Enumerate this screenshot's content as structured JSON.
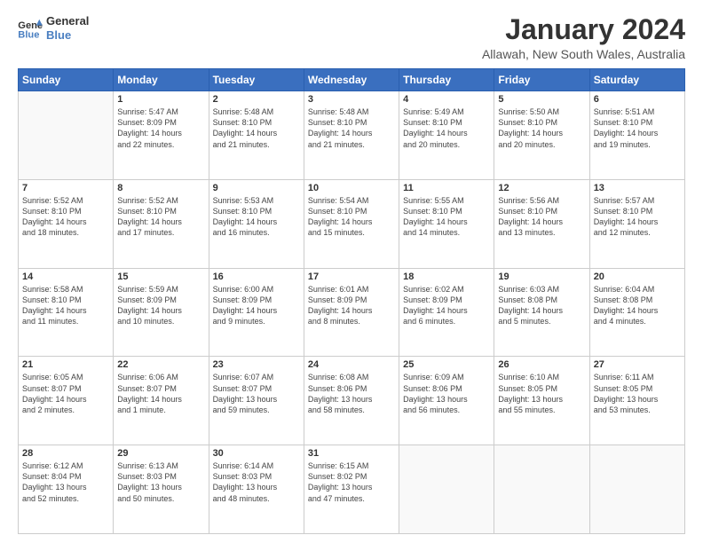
{
  "logo": {
    "line1": "General",
    "line2": "Blue"
  },
  "title": "January 2024",
  "subtitle": "Allawah, New South Wales, Australia",
  "weekdays": [
    "Sunday",
    "Monday",
    "Tuesday",
    "Wednesday",
    "Thursday",
    "Friday",
    "Saturday"
  ],
  "weeks": [
    [
      {
        "day": "",
        "info": ""
      },
      {
        "day": "1",
        "info": "Sunrise: 5:47 AM\nSunset: 8:09 PM\nDaylight: 14 hours\nand 22 minutes."
      },
      {
        "day": "2",
        "info": "Sunrise: 5:48 AM\nSunset: 8:10 PM\nDaylight: 14 hours\nand 21 minutes."
      },
      {
        "day": "3",
        "info": "Sunrise: 5:48 AM\nSunset: 8:10 PM\nDaylight: 14 hours\nand 21 minutes."
      },
      {
        "day": "4",
        "info": "Sunrise: 5:49 AM\nSunset: 8:10 PM\nDaylight: 14 hours\nand 20 minutes."
      },
      {
        "day": "5",
        "info": "Sunrise: 5:50 AM\nSunset: 8:10 PM\nDaylight: 14 hours\nand 20 minutes."
      },
      {
        "day": "6",
        "info": "Sunrise: 5:51 AM\nSunset: 8:10 PM\nDaylight: 14 hours\nand 19 minutes."
      }
    ],
    [
      {
        "day": "7",
        "info": "Sunrise: 5:52 AM\nSunset: 8:10 PM\nDaylight: 14 hours\nand 18 minutes."
      },
      {
        "day": "8",
        "info": "Sunrise: 5:52 AM\nSunset: 8:10 PM\nDaylight: 14 hours\nand 17 minutes."
      },
      {
        "day": "9",
        "info": "Sunrise: 5:53 AM\nSunset: 8:10 PM\nDaylight: 14 hours\nand 16 minutes."
      },
      {
        "day": "10",
        "info": "Sunrise: 5:54 AM\nSunset: 8:10 PM\nDaylight: 14 hours\nand 15 minutes."
      },
      {
        "day": "11",
        "info": "Sunrise: 5:55 AM\nSunset: 8:10 PM\nDaylight: 14 hours\nand 14 minutes."
      },
      {
        "day": "12",
        "info": "Sunrise: 5:56 AM\nSunset: 8:10 PM\nDaylight: 14 hours\nand 13 minutes."
      },
      {
        "day": "13",
        "info": "Sunrise: 5:57 AM\nSunset: 8:10 PM\nDaylight: 14 hours\nand 12 minutes."
      }
    ],
    [
      {
        "day": "14",
        "info": "Sunrise: 5:58 AM\nSunset: 8:10 PM\nDaylight: 14 hours\nand 11 minutes."
      },
      {
        "day": "15",
        "info": "Sunrise: 5:59 AM\nSunset: 8:09 PM\nDaylight: 14 hours\nand 10 minutes."
      },
      {
        "day": "16",
        "info": "Sunrise: 6:00 AM\nSunset: 8:09 PM\nDaylight: 14 hours\nand 9 minutes."
      },
      {
        "day": "17",
        "info": "Sunrise: 6:01 AM\nSunset: 8:09 PM\nDaylight: 14 hours\nand 8 minutes."
      },
      {
        "day": "18",
        "info": "Sunrise: 6:02 AM\nSunset: 8:09 PM\nDaylight: 14 hours\nand 6 minutes."
      },
      {
        "day": "19",
        "info": "Sunrise: 6:03 AM\nSunset: 8:08 PM\nDaylight: 14 hours\nand 5 minutes."
      },
      {
        "day": "20",
        "info": "Sunrise: 6:04 AM\nSunset: 8:08 PM\nDaylight: 14 hours\nand 4 minutes."
      }
    ],
    [
      {
        "day": "21",
        "info": "Sunrise: 6:05 AM\nSunset: 8:07 PM\nDaylight: 14 hours\nand 2 minutes."
      },
      {
        "day": "22",
        "info": "Sunrise: 6:06 AM\nSunset: 8:07 PM\nDaylight: 14 hours\nand 1 minute."
      },
      {
        "day": "23",
        "info": "Sunrise: 6:07 AM\nSunset: 8:07 PM\nDaylight: 13 hours\nand 59 minutes."
      },
      {
        "day": "24",
        "info": "Sunrise: 6:08 AM\nSunset: 8:06 PM\nDaylight: 13 hours\nand 58 minutes."
      },
      {
        "day": "25",
        "info": "Sunrise: 6:09 AM\nSunset: 8:06 PM\nDaylight: 13 hours\nand 56 minutes."
      },
      {
        "day": "26",
        "info": "Sunrise: 6:10 AM\nSunset: 8:05 PM\nDaylight: 13 hours\nand 55 minutes."
      },
      {
        "day": "27",
        "info": "Sunrise: 6:11 AM\nSunset: 8:05 PM\nDaylight: 13 hours\nand 53 minutes."
      }
    ],
    [
      {
        "day": "28",
        "info": "Sunrise: 6:12 AM\nSunset: 8:04 PM\nDaylight: 13 hours\nand 52 minutes."
      },
      {
        "day": "29",
        "info": "Sunrise: 6:13 AM\nSunset: 8:03 PM\nDaylight: 13 hours\nand 50 minutes."
      },
      {
        "day": "30",
        "info": "Sunrise: 6:14 AM\nSunset: 8:03 PM\nDaylight: 13 hours\nand 48 minutes."
      },
      {
        "day": "31",
        "info": "Sunrise: 6:15 AM\nSunset: 8:02 PM\nDaylight: 13 hours\nand 47 minutes."
      },
      {
        "day": "",
        "info": ""
      },
      {
        "day": "",
        "info": ""
      },
      {
        "day": "",
        "info": ""
      }
    ]
  ]
}
